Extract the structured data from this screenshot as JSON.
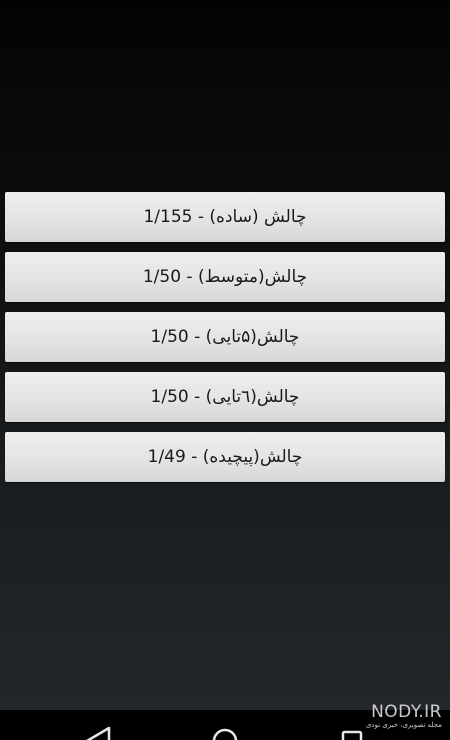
{
  "challenges": [
    {
      "label": "چالش  (ساده) - 1/155"
    },
    {
      "label": "چالش(متوسط) - 1/50"
    },
    {
      "label": "چالش(۵تایی) - 1/50"
    },
    {
      "label": "چالش(٦تایی) - 1/50"
    },
    {
      "label": "چالش(پیچیده) - 1/49"
    }
  ],
  "navbar": {
    "back_icon": "back-triangle-icon",
    "home_icon": "home-circle-icon",
    "recents_icon": "recents-square-icon"
  },
  "watermark": {
    "brand": "NODY.IR",
    "tagline": "مجله تصویری، خبری نودی"
  },
  "colors": {
    "button_bg": "#e6e6e6",
    "button_text": "#1a1a1a",
    "background_top": "#030303",
    "background_bottom": "#24272b",
    "navbar": "#000000"
  }
}
